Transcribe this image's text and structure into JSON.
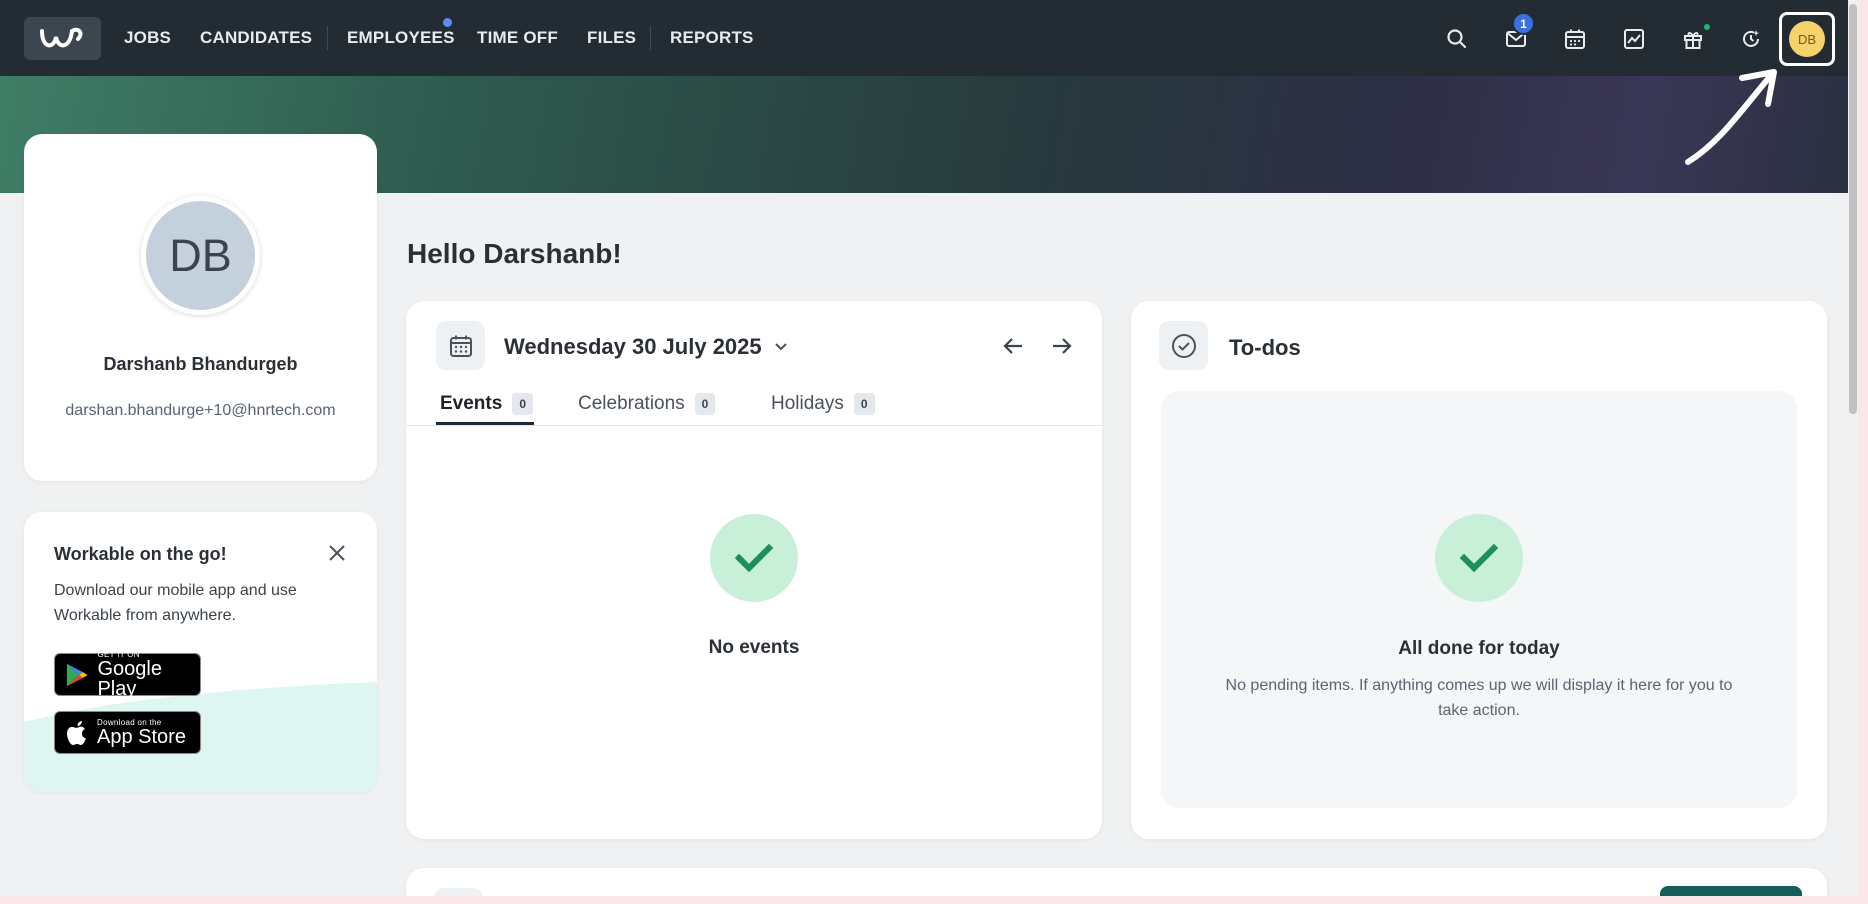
{
  "nav": {
    "links": [
      "JOBS",
      "CANDIDATES",
      "EMPLOYEES",
      "TIME OFF",
      "FILES",
      "REPORTS"
    ],
    "mail_badge": "1",
    "avatar_initials": "DB"
  },
  "profile": {
    "initials": "DB",
    "name": "Darshanb Bhandurgeb",
    "email": "darshan.bhandurge+10@hnrtech.com"
  },
  "mobile_promo": {
    "title": "Workable on the go!",
    "text": "Download our mobile app and use Workable from anywhere.",
    "google_small": "GET IT ON",
    "google_big": "Google Play",
    "apple_small": "Download on the",
    "apple_big": "App Store"
  },
  "greeting": "Hello Darshanb!",
  "events": {
    "date": "Wednesday 30 July 2025",
    "tabs": [
      {
        "label": "Events",
        "count": "0"
      },
      {
        "label": "Celebrations",
        "count": "0"
      },
      {
        "label": "Holidays",
        "count": "0"
      }
    ],
    "empty_title": "No events"
  },
  "todos": {
    "title": "To-dos",
    "empty_title": "All done for today",
    "empty_text": "No pending items. If anything comes up we will display it here for you to take action."
  },
  "colors": {
    "nav_bg": "#232b33",
    "accent_green": "#1e8f5a",
    "check_bg": "#c8efd8",
    "avatar_yellow": "#f5d36a"
  }
}
